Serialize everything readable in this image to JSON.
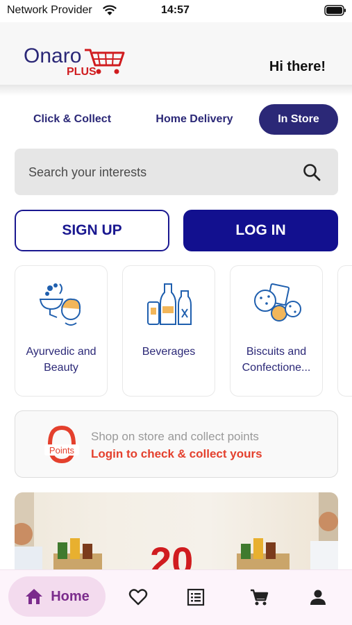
{
  "status_bar": {
    "carrier": "Network Provider",
    "time": "14:57"
  },
  "header": {
    "logo_text": "Onaro",
    "logo_subtext": "PLUS",
    "greeting": "Hi there!"
  },
  "mode_tabs": [
    {
      "label": "Click & Collect",
      "active": false
    },
    {
      "label": "Home Delivery",
      "active": false
    },
    {
      "label": "In Store",
      "active": true
    }
  ],
  "search": {
    "placeholder": "Search your interests"
  },
  "auth": {
    "signup_label": "SIGN UP",
    "login_label": "LOG IN"
  },
  "categories": [
    {
      "label": "Ayurvedic and Beauty",
      "icon": "ayurvedic-beauty-icon"
    },
    {
      "label": "Beverages",
      "icon": "beverages-icon"
    },
    {
      "label": "Biscuits and Confectione...",
      "icon": "biscuits-icon"
    }
  ],
  "points": {
    "icon_text": "Points",
    "title": "Shop on store and collect points",
    "link": "Login to check & collect yours"
  },
  "promo": {
    "number": "20"
  },
  "bottom_nav": {
    "home_label": "Home"
  },
  "colors": {
    "primary": "#12108f",
    "tab_active": "#2b2877",
    "accent_red": "#e4402d",
    "nav_active_bg": "#f3dbee",
    "nav_active_fg": "#7b2c8c"
  }
}
